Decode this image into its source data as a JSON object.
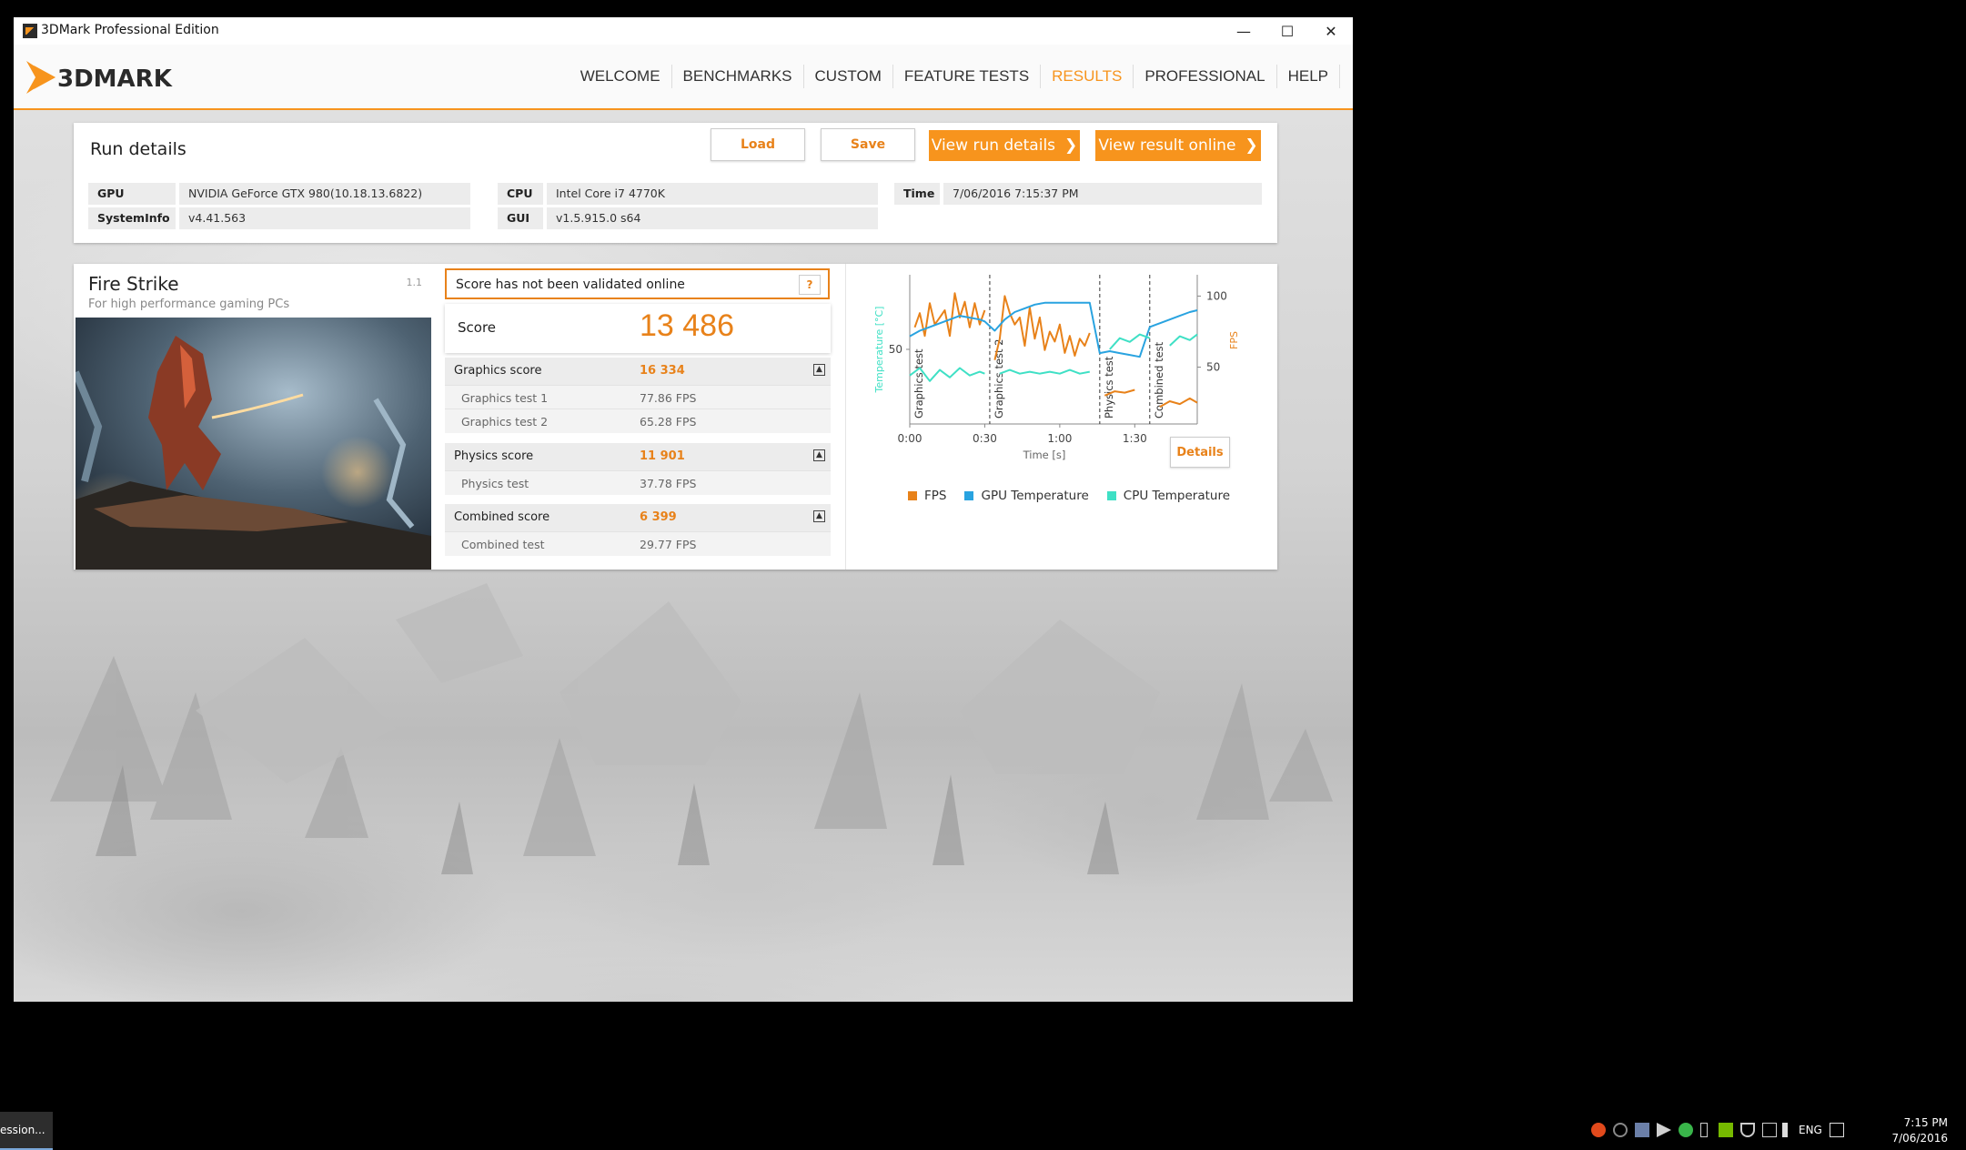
{
  "window": {
    "title": "3DMark Professional Edition",
    "controls": {
      "minimize": "—",
      "maximize": "☐",
      "close": "✕"
    }
  },
  "nav": {
    "logo_text": "3DMARK",
    "items": [
      "WELCOME",
      "BENCHMARKS",
      "CUSTOM",
      "FEATURE TESTS",
      "RESULTS",
      "PROFESSIONAL",
      "HELP"
    ],
    "active": "RESULTS"
  },
  "run_details": {
    "heading": "Run details",
    "load": "Load",
    "save": "Save",
    "view_run_details": "View run details",
    "view_result_online": "View result online",
    "chevron": "❯",
    "gpu_label": "GPU",
    "gpu_value": "NVIDIA GeForce GTX 980(10.18.13.6822)",
    "sysinfo_label": "SystemInfo",
    "sysinfo_value": "v4.41.563",
    "cpu_label": "CPU",
    "cpu_value": "Intel Core i7 4770K",
    "gui_label": "GUI",
    "gui_value": "v1.5.915.0 s64",
    "time_label": "Time",
    "time_value": "7/06/2016 7:15:37 PM"
  },
  "fire_strike": {
    "name": "Fire Strike",
    "subtitle": "For high performance gaming PCs",
    "version": "1.1",
    "validation": "Score has not been validated online",
    "help": "?",
    "score_label": "Score",
    "score_value": "13 486",
    "toggle_glyph": "▲",
    "graphics_label": "Graphics score",
    "graphics_value": "16 334",
    "gt1_label": "Graphics test 1",
    "gt1_value": "77.86 FPS",
    "gt2_label": "Graphics test 2",
    "gt2_value": "65.28 FPS",
    "physics_label": "Physics score",
    "physics_value": "11 901",
    "pt_label": "Physics test",
    "pt_value": "37.78 FPS",
    "combined_label": "Combined score",
    "combined_value": "6 399",
    "ct_label": "Combined test",
    "ct_value": "29.77 FPS"
  },
  "monitor": {
    "details": "Details",
    "colors": {
      "fps": "#e8821a",
      "gpu": "#29a3e0",
      "cpu": "#3fe0c5"
    }
  },
  "chart_data": {
    "type": "line",
    "xlabel": "Time [s]",
    "ylabel_left": "Temperature [°C]",
    "ylabel_right": "FPS",
    "x_ticks": [
      "0:00",
      "0:30",
      "1:00",
      "1:30"
    ],
    "y_left_ticks": [
      50
    ],
    "y_right_ticks": [
      50,
      100
    ],
    "xlim": [
      0,
      115
    ],
    "ylim_left": [
      10,
      90
    ],
    "ylim_right": [
      10,
      115
    ],
    "sections": [
      {
        "label": "Graphics test",
        "start": 0
      },
      {
        "label": "Graphics test 2",
        "start": 32
      },
      {
        "label": "Physics test",
        "start": 76
      },
      {
        "label": "Combined test",
        "start": 96
      }
    ],
    "series": [
      {
        "name": "FPS",
        "axis": "right",
        "x": [
          2,
          4,
          6,
          8,
          10,
          12,
          14,
          16,
          18,
          20,
          22,
          24,
          26,
          28,
          30,
          32,
          34,
          36,
          38,
          40,
          42,
          44,
          46,
          48,
          50,
          52,
          54,
          56,
          58,
          60,
          62,
          64,
          66,
          68,
          70,
          72,
          76,
          78,
          82,
          86,
          90,
          96,
          100,
          104,
          108,
          112,
          115
        ],
        "values": [
          78,
          88,
          72,
          95,
          80,
          85,
          90,
          72,
          102,
          85,
          96,
          78,
          95,
          80,
          90,
          null,
          55,
          70,
          100,
          88,
          80,
          85,
          65,
          92,
          70,
          85,
          62,
          75,
          68,
          80,
          60,
          72,
          58,
          70,
          65,
          74,
          null,
          30,
          33,
          32,
          34,
          null,
          22,
          26,
          24,
          28,
          25
        ]
      },
      {
        "name": "GPU Temperature",
        "axis": "left",
        "x": [
          0,
          4,
          8,
          12,
          16,
          20,
          24,
          28,
          30,
          34,
          38,
          42,
          46,
          50,
          54,
          58,
          62,
          66,
          70,
          72,
          76,
          80,
          84,
          88,
          92,
          96,
          100,
          104,
          108,
          112,
          115
        ],
        "values": [
          57,
          60,
          62,
          64,
          66,
          68,
          67,
          66,
          65,
          60,
          66,
          70,
          72,
          74,
          75,
          75,
          75,
          75,
          75,
          75,
          48,
          49,
          48,
          47,
          46,
          62,
          64,
          66,
          68,
          70,
          71
        ]
      },
      {
        "name": "CPU Temperature",
        "axis": "left",
        "x": [
          0,
          4,
          8,
          12,
          16,
          20,
          24,
          28,
          30,
          32,
          36,
          40,
          44,
          48,
          52,
          56,
          60,
          64,
          68,
          72,
          76,
          80,
          84,
          88,
          92,
          96,
          100,
          104,
          108,
          112,
          115
        ],
        "values": [
          36,
          40,
          33,
          39,
          35,
          40,
          36,
          38,
          37,
          null,
          37,
          39,
          37,
          38,
          37,
          38,
          37,
          39,
          37,
          38,
          null,
          50,
          56,
          54,
          58,
          56,
          null,
          52,
          57,
          55,
          58
        ]
      }
    ]
  },
  "taskbar": {
    "app_label": "ession...",
    "lang": "ENG",
    "time": "7:15 PM",
    "date": "7/06/2016"
  }
}
